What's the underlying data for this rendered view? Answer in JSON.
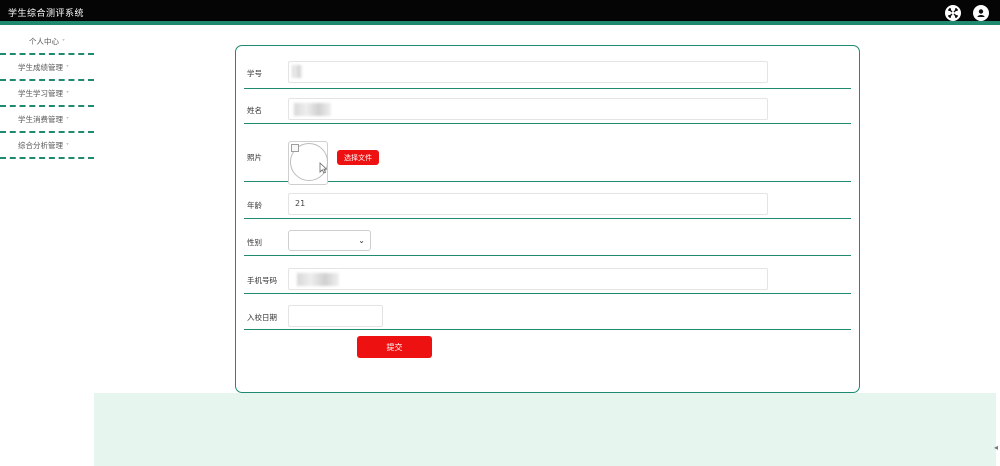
{
  "app": {
    "title": "学生综合测评系统",
    "icons": [
      "fullscreen-icon",
      "user-icon"
    ]
  },
  "sidebar": {
    "items": [
      {
        "label": "个人中心"
      },
      {
        "label": "学生成绩管理"
      },
      {
        "label": "学生学习管理"
      },
      {
        "label": "学生消费管理"
      },
      {
        "label": "综合分析管理"
      }
    ],
    "caret": "˅"
  },
  "form": {
    "fields": [
      {
        "label": "学号",
        "value": ""
      },
      {
        "label": "姓名",
        "value": ""
      },
      {
        "label": "照片",
        "value": ""
      },
      {
        "label": "年龄",
        "value": "21"
      },
      {
        "label": "性别",
        "value": ""
      },
      {
        "label": "手机号码",
        "value": ""
      },
      {
        "label": "入校日期",
        "value": ""
      }
    ],
    "upload_label": "选择文件",
    "select_arrow": "⌄",
    "submit_label": "提交"
  },
  "colors": {
    "header_bg": "#050505",
    "accent": "#1f8a70",
    "button": "#ee1111",
    "footer": "#e7f5ef"
  }
}
